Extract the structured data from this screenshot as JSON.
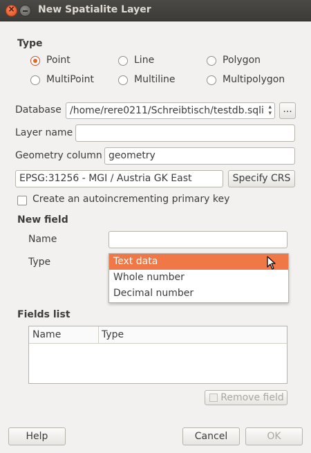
{
  "window": {
    "title": "New Spatialite Layer"
  },
  "type_section": {
    "heading": "Type",
    "options": [
      "Point",
      "Line",
      "Polygon",
      "MultiPoint",
      "Multiline",
      "Multipolygon"
    ],
    "selected": "Point"
  },
  "database": {
    "label": "Database",
    "value": "/home/rere0211/Schreibtisch/testdb.sqli",
    "browse_label": "..."
  },
  "layer_name": {
    "label": "Layer name",
    "value": ""
  },
  "geometry_column": {
    "label": "Geometry column",
    "value": "geometry"
  },
  "crs": {
    "value": "EPSG:31256 - MGI / Austria GK East",
    "button_label": "Specify CRS"
  },
  "primary_key": {
    "label": "Create an autoincrementing primary key",
    "checked": false
  },
  "new_field": {
    "heading": "New field",
    "name_label": "Name",
    "name_value": "",
    "type_label": "Type",
    "type_options": [
      "Text data",
      "Whole number",
      "Decimal number"
    ],
    "type_highlighted": "Text data"
  },
  "fields_list": {
    "heading": "Fields list",
    "columns": [
      "Name",
      "Type"
    ],
    "rows": [],
    "remove_label": "Remove field"
  },
  "footer": {
    "help_label": "Help",
    "cancel_label": "Cancel",
    "ok_label": "OK"
  }
}
